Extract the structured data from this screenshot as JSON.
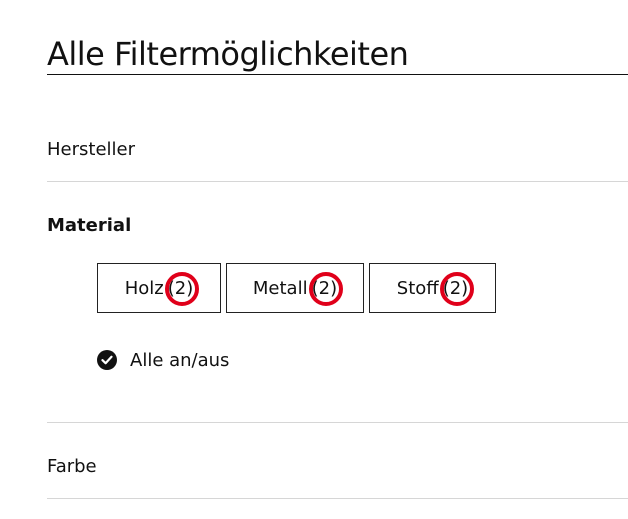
{
  "page": {
    "title": "Alle Filtermöglichkeiten"
  },
  "filters": {
    "manufacturer": {
      "label": "Hersteller"
    },
    "material": {
      "label": "Material",
      "options": [
        {
          "name": "Holz",
          "count": "(2)"
        },
        {
          "name": "Metall",
          "count": "(2)"
        },
        {
          "name": "Stoff",
          "count": "(2)"
        }
      ],
      "toggle_all_label": "Alle an/aus"
    },
    "color": {
      "label": "Farbe"
    }
  },
  "colors": {
    "text": "#111111",
    "divider": "#d6d6d6",
    "highlight_ring": "#e0001a"
  },
  "icons": {
    "toggle_all": "check-circle-icon"
  }
}
